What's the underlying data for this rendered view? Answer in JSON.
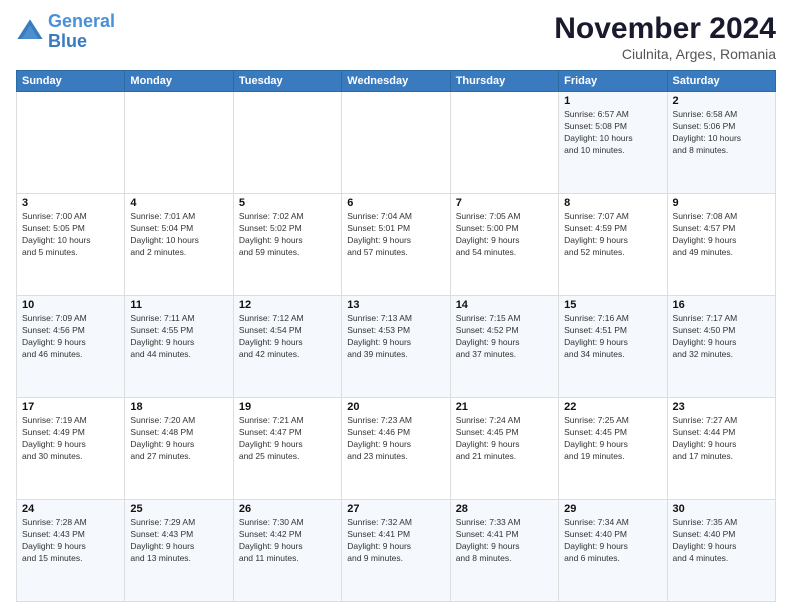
{
  "header": {
    "logo_line1": "General",
    "logo_line2": "Blue",
    "month": "November 2024",
    "location": "Ciulnita, Arges, Romania"
  },
  "days_of_week": [
    "Sunday",
    "Monday",
    "Tuesday",
    "Wednesday",
    "Thursday",
    "Friday",
    "Saturday"
  ],
  "weeks": [
    [
      {
        "day": "",
        "info": ""
      },
      {
        "day": "",
        "info": ""
      },
      {
        "day": "",
        "info": ""
      },
      {
        "day": "",
        "info": ""
      },
      {
        "day": "",
        "info": ""
      },
      {
        "day": "1",
        "info": "Sunrise: 6:57 AM\nSunset: 5:08 PM\nDaylight: 10 hours\nand 10 minutes."
      },
      {
        "day": "2",
        "info": "Sunrise: 6:58 AM\nSunset: 5:06 PM\nDaylight: 10 hours\nand 8 minutes."
      }
    ],
    [
      {
        "day": "3",
        "info": "Sunrise: 7:00 AM\nSunset: 5:05 PM\nDaylight: 10 hours\nand 5 minutes."
      },
      {
        "day": "4",
        "info": "Sunrise: 7:01 AM\nSunset: 5:04 PM\nDaylight: 10 hours\nand 2 minutes."
      },
      {
        "day": "5",
        "info": "Sunrise: 7:02 AM\nSunset: 5:02 PM\nDaylight: 9 hours\nand 59 minutes."
      },
      {
        "day": "6",
        "info": "Sunrise: 7:04 AM\nSunset: 5:01 PM\nDaylight: 9 hours\nand 57 minutes."
      },
      {
        "day": "7",
        "info": "Sunrise: 7:05 AM\nSunset: 5:00 PM\nDaylight: 9 hours\nand 54 minutes."
      },
      {
        "day": "8",
        "info": "Sunrise: 7:07 AM\nSunset: 4:59 PM\nDaylight: 9 hours\nand 52 minutes."
      },
      {
        "day": "9",
        "info": "Sunrise: 7:08 AM\nSunset: 4:57 PM\nDaylight: 9 hours\nand 49 minutes."
      }
    ],
    [
      {
        "day": "10",
        "info": "Sunrise: 7:09 AM\nSunset: 4:56 PM\nDaylight: 9 hours\nand 46 minutes."
      },
      {
        "day": "11",
        "info": "Sunrise: 7:11 AM\nSunset: 4:55 PM\nDaylight: 9 hours\nand 44 minutes."
      },
      {
        "day": "12",
        "info": "Sunrise: 7:12 AM\nSunset: 4:54 PM\nDaylight: 9 hours\nand 42 minutes."
      },
      {
        "day": "13",
        "info": "Sunrise: 7:13 AM\nSunset: 4:53 PM\nDaylight: 9 hours\nand 39 minutes."
      },
      {
        "day": "14",
        "info": "Sunrise: 7:15 AM\nSunset: 4:52 PM\nDaylight: 9 hours\nand 37 minutes."
      },
      {
        "day": "15",
        "info": "Sunrise: 7:16 AM\nSunset: 4:51 PM\nDaylight: 9 hours\nand 34 minutes."
      },
      {
        "day": "16",
        "info": "Sunrise: 7:17 AM\nSunset: 4:50 PM\nDaylight: 9 hours\nand 32 minutes."
      }
    ],
    [
      {
        "day": "17",
        "info": "Sunrise: 7:19 AM\nSunset: 4:49 PM\nDaylight: 9 hours\nand 30 minutes."
      },
      {
        "day": "18",
        "info": "Sunrise: 7:20 AM\nSunset: 4:48 PM\nDaylight: 9 hours\nand 27 minutes."
      },
      {
        "day": "19",
        "info": "Sunrise: 7:21 AM\nSunset: 4:47 PM\nDaylight: 9 hours\nand 25 minutes."
      },
      {
        "day": "20",
        "info": "Sunrise: 7:23 AM\nSunset: 4:46 PM\nDaylight: 9 hours\nand 23 minutes."
      },
      {
        "day": "21",
        "info": "Sunrise: 7:24 AM\nSunset: 4:45 PM\nDaylight: 9 hours\nand 21 minutes."
      },
      {
        "day": "22",
        "info": "Sunrise: 7:25 AM\nSunset: 4:45 PM\nDaylight: 9 hours\nand 19 minutes."
      },
      {
        "day": "23",
        "info": "Sunrise: 7:27 AM\nSunset: 4:44 PM\nDaylight: 9 hours\nand 17 minutes."
      }
    ],
    [
      {
        "day": "24",
        "info": "Sunrise: 7:28 AM\nSunset: 4:43 PM\nDaylight: 9 hours\nand 15 minutes."
      },
      {
        "day": "25",
        "info": "Sunrise: 7:29 AM\nSunset: 4:43 PM\nDaylight: 9 hours\nand 13 minutes."
      },
      {
        "day": "26",
        "info": "Sunrise: 7:30 AM\nSunset: 4:42 PM\nDaylight: 9 hours\nand 11 minutes."
      },
      {
        "day": "27",
        "info": "Sunrise: 7:32 AM\nSunset: 4:41 PM\nDaylight: 9 hours\nand 9 minutes."
      },
      {
        "day": "28",
        "info": "Sunrise: 7:33 AM\nSunset: 4:41 PM\nDaylight: 9 hours\nand 8 minutes."
      },
      {
        "day": "29",
        "info": "Sunrise: 7:34 AM\nSunset: 4:40 PM\nDaylight: 9 hours\nand 6 minutes."
      },
      {
        "day": "30",
        "info": "Sunrise: 7:35 AM\nSunset: 4:40 PM\nDaylight: 9 hours\nand 4 minutes."
      }
    ]
  ]
}
